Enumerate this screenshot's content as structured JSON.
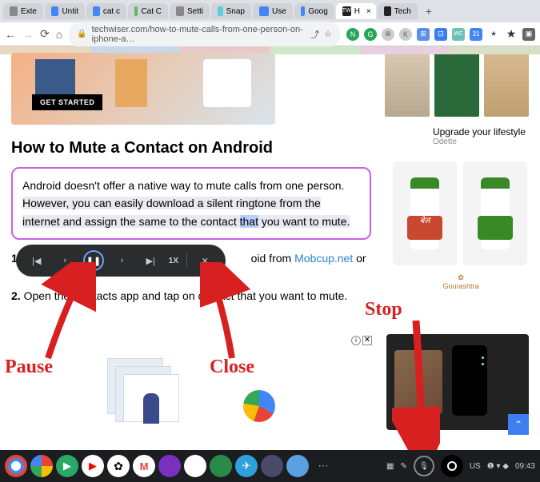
{
  "browser": {
    "tabs": [
      {
        "label": "Exte"
      },
      {
        "label": "Untit"
      },
      {
        "label": "cat c"
      },
      {
        "label": "Cat C"
      },
      {
        "label": "Setti"
      },
      {
        "label": "Snap"
      },
      {
        "label": "Use"
      },
      {
        "label": "Goog"
      },
      {
        "label": "H",
        "active": true
      },
      {
        "label": "Tech"
      }
    ],
    "new_tab": "+",
    "nav": {
      "back": "←",
      "forward": "→",
      "reload": "⟳",
      "home": "⌂"
    },
    "url": "techwiser.com/how-to-mute-calls-from-one-person-on-iphone-a…",
    "ext": [
      "N",
      "G",
      "⊕",
      "K",
      "⊞",
      "⊡",
      "WC",
      "31",
      "★",
      "★",
      "▣"
    ]
  },
  "hero": {
    "cta": "GET STARTED"
  },
  "upgrade": {
    "title": "Upgrade your lifestyle",
    "sub": "Odette"
  },
  "article": {
    "heading": "How to Mute a Contact on Android",
    "highlight_p1": "Android doesn't offer a native way to mute calls from one person. ",
    "highlight_sel_pre": "However, you can easily download a silent ringtone from the internet and assign the same to the contact ",
    "highlight_sel_word": "that",
    "highlight_sel_post": " you want to mute.",
    "step1_pre": "1. ",
    "step1_mid": "oid from ",
    "step1_link": "Mobcup.net",
    "step1_post": " or",
    "step2_pre": "2. ",
    "step2_text": "Open the Contacts app and tap on        contact that you want to mute."
  },
  "media": {
    "prev_track": "|◀",
    "prev": "‹",
    "pause": "❚❚",
    "next": "›",
    "next_track": "▶|",
    "rate": "1X",
    "close": "✕"
  },
  "annotations": {
    "pause": "Pause",
    "close": "Close",
    "stop": "Stop"
  },
  "ad": {
    "info": "i",
    "close": "✕"
  },
  "scroll_top": "⌃",
  "taskbar": {
    "apps": [
      "◉",
      "⬤",
      "▶",
      "▶",
      "✿",
      "M",
      "▦",
      "▦",
      "⬤",
      "✈",
      "⬤",
      "⬤",
      "⋯"
    ],
    "mic": "🎤",
    "lang": "US",
    "status": "❶ ▾ ◆",
    "time": "09:43"
  }
}
